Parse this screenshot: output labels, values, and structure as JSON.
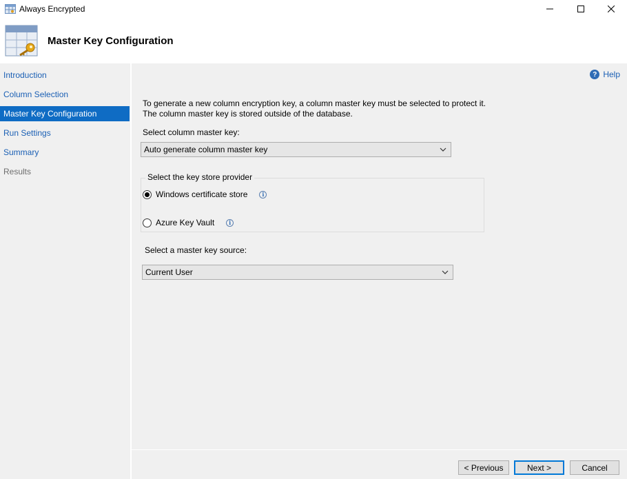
{
  "window": {
    "title": "Always Encrypted",
    "controls": [
      "minimize-icon",
      "maximize-icon",
      "close-icon"
    ]
  },
  "header": {
    "title": "Master Key Configuration",
    "icon": "table-key-icon"
  },
  "sidebar": {
    "items": [
      {
        "label": "Introduction",
        "state": "link"
      },
      {
        "label": "Column Selection",
        "state": "link"
      },
      {
        "label": "Master Key Configuration",
        "state": "active"
      },
      {
        "label": "Run Settings",
        "state": "link"
      },
      {
        "label": "Summary",
        "state": "link"
      },
      {
        "label": "Results",
        "state": "disabled"
      }
    ]
  },
  "main": {
    "help_label": "Help",
    "description": "To generate a new column encryption key, a column master key must be selected to protect it.  The column master key is stored outside of the database.",
    "master_key": {
      "label": "Select column master key:",
      "value": "Auto generate column master key"
    },
    "key_store": {
      "legend": "Select the key store provider",
      "options": [
        {
          "label": "Windows certificate store",
          "checked": true
        },
        {
          "label": "Azure Key Vault",
          "checked": false
        }
      ]
    },
    "key_source": {
      "label": "Select a master key source:",
      "value": "Current User"
    }
  },
  "footer": {
    "previous_label": "< Previous",
    "next_label": "Next >",
    "cancel_label": "Cancel"
  },
  "colors": {
    "accent": "#0f6cc4",
    "link": "#1a5fb4",
    "background": "#f0f0f0"
  }
}
